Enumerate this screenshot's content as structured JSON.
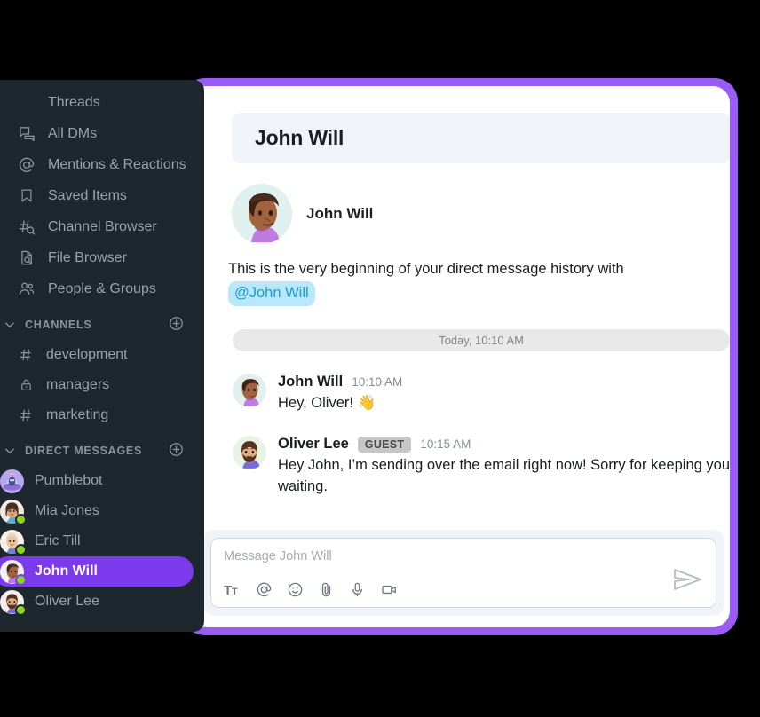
{
  "theme": {
    "accent_purple": "#7c3aed",
    "glow_purple": "#9b5cf6",
    "sidebar_bg": "#1e262e",
    "panel_bg": "#ffffff",
    "header_bg": "#f0f4f8",
    "mention_bg": "#b9e7fb",
    "mention_fg": "#1d9bd1",
    "presence_online": "#8ed222",
    "page_bg": "#000000"
  },
  "sidebar": {
    "nav": [
      {
        "label": "Threads",
        "icon": "threads-icon"
      },
      {
        "label": "All DMs",
        "icon": "all-dms-icon"
      },
      {
        "label": "Mentions & Reactions",
        "icon": "at-mention-icon"
      },
      {
        "label": "Saved Items",
        "icon": "bookmark-icon"
      },
      {
        "label": "Channel Browser",
        "icon": "channel-search-icon"
      },
      {
        "label": "File Browser",
        "icon": "file-search-icon"
      },
      {
        "label": "People & Groups",
        "icon": "people-icon"
      }
    ],
    "channels_section": {
      "label": "CHANNELS",
      "collapse_icon": "chevron-down-icon",
      "add_icon": "plus-circle-icon",
      "items": [
        {
          "label": "development",
          "icon": "hash-icon"
        },
        {
          "label": "managers",
          "icon": "lock-icon"
        },
        {
          "label": "marketing",
          "icon": "hash-icon"
        }
      ]
    },
    "dm_section": {
      "label": "DIRECT MESSAGES",
      "collapse_icon": "chevron-down-icon",
      "add_icon": "plus-circle-icon",
      "items": [
        {
          "label": "Pumblebot",
          "avatar": "bot",
          "presence": false,
          "active": false
        },
        {
          "label": "Mia Jones",
          "avatar": "mia",
          "presence": true,
          "active": false
        },
        {
          "label": "Eric Till",
          "avatar": "eric",
          "presence": true,
          "active": false
        },
        {
          "label": "John Will",
          "avatar": "john",
          "presence": true,
          "active": true
        },
        {
          "label": "Oliver Lee",
          "avatar": "oliver",
          "presence": true,
          "active": false
        }
      ]
    }
  },
  "chat": {
    "header_title": "John Will",
    "intro": {
      "name": "John Will",
      "avatar": "john",
      "text_before": "This is the very beginning of your direct message history with",
      "mention": "@John Will"
    },
    "date_divider": "Today, 10:10 AM",
    "messages": [
      {
        "author": "John Will",
        "avatar": "john",
        "badge": "",
        "time": "10:10 AM",
        "text": "Hey, Oliver! 👋"
      },
      {
        "author": "Oliver Lee",
        "avatar": "oliver",
        "badge": "GUEST",
        "time": "10:15 AM",
        "text": "Hey John, I’m sending over the email right now! Sorry for keeping you waiting."
      }
    ],
    "composer": {
      "placeholder": "Message John Will",
      "tools": [
        {
          "name": "text-format-icon",
          "title": "Tt"
        },
        {
          "name": "at-mention-icon",
          "title": "@"
        },
        {
          "name": "emoji-icon",
          "title": "Emoji"
        },
        {
          "name": "attachment-icon",
          "title": "Attach"
        },
        {
          "name": "microphone-icon",
          "title": "Record audio"
        },
        {
          "name": "video-camera-icon",
          "title": "Record video"
        }
      ],
      "send_label": "Send"
    }
  }
}
